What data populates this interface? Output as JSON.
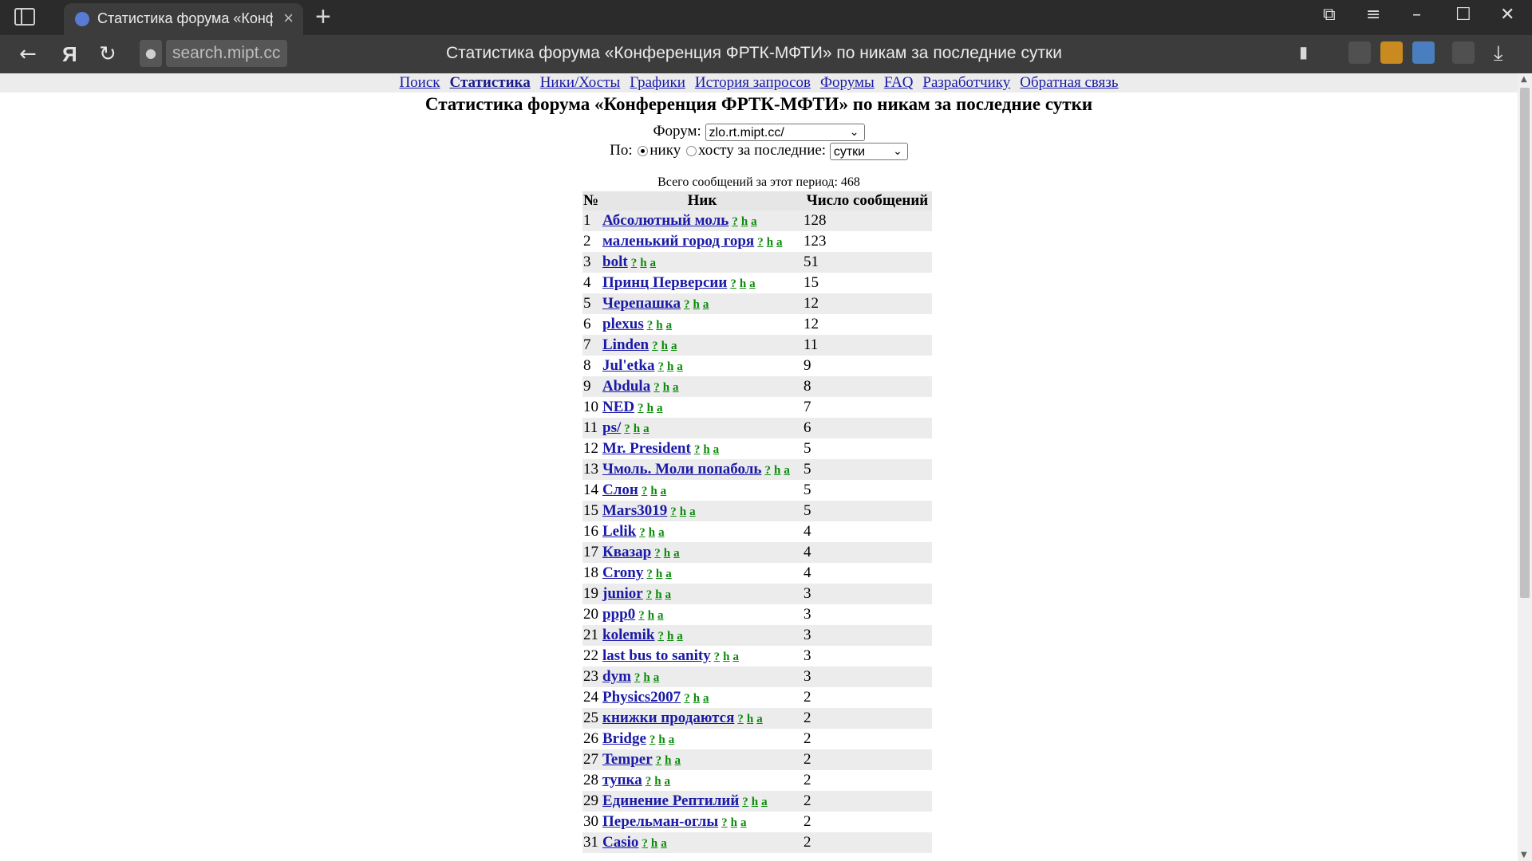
{
  "browser": {
    "tab_title": "Статистика форума «Конф",
    "address_host": "search.mipt.cc",
    "address_title": "Статистика форума «Конференция ФРТК-МФТИ» по никам за последние сутки"
  },
  "menu": [
    {
      "label": "Поиск",
      "active": false
    },
    {
      "label": "Статистика",
      "active": true
    },
    {
      "label": "Ники/Хосты",
      "active": false
    },
    {
      "label": "Графики",
      "active": false
    },
    {
      "label": "История запросов",
      "active": false
    },
    {
      "label": "Форумы",
      "active": false
    },
    {
      "label": "FAQ",
      "active": false
    },
    {
      "label": "Разработчику",
      "active": false
    },
    {
      "label": "Обратная связь",
      "active": false
    }
  ],
  "page_title": "Статистика форума «Конференция ФРТК-МФТИ» по никам за последние сутки",
  "form": {
    "forum_label": "Форум:",
    "forum_value": "zlo.rt.mipt.cc/",
    "by_label": "По:",
    "radio_nick": "нику",
    "radio_host": "хосту за последние:",
    "period_value": "сутки"
  },
  "total": "Всего сообщений за этот период: 468",
  "table": {
    "headers": [
      "№",
      "Ник",
      "Число сообщений"
    ],
    "link_labels": [
      "?",
      "h",
      "a"
    ],
    "rows": [
      {
        "n": "1",
        "nick": "Абсолютный моль",
        "count": "128"
      },
      {
        "n": "2",
        "nick": "маленький город горя",
        "count": "123"
      },
      {
        "n": "3",
        "nick": "bolt",
        "count": "51"
      },
      {
        "n": "4",
        "nick": "Принц Перверсии",
        "count": "15"
      },
      {
        "n": "5",
        "nick": "Черепашка",
        "count": "12"
      },
      {
        "n": "6",
        "nick": "plexus",
        "count": "12"
      },
      {
        "n": "7",
        "nick": "Linden",
        "count": "11"
      },
      {
        "n": "8",
        "nick": "Jul'etka",
        "count": "9"
      },
      {
        "n": "9",
        "nick": "Abdula",
        "count": "8"
      },
      {
        "n": "10",
        "nick": "NED",
        "count": "7"
      },
      {
        "n": "11",
        "nick": "ps/",
        "count": "6"
      },
      {
        "n": "12",
        "nick": "Mr. President",
        "count": "5"
      },
      {
        "n": "13",
        "nick": "Чмоль. Моли попаболь",
        "count": "5"
      },
      {
        "n": "14",
        "nick": "Слон",
        "count": "5"
      },
      {
        "n": "15",
        "nick": "Mars3019",
        "count": "5"
      },
      {
        "n": "16",
        "nick": "Lelik",
        "count": "4"
      },
      {
        "n": "17",
        "nick": "Квазар",
        "count": "4"
      },
      {
        "n": "18",
        "nick": "Crony",
        "count": "4"
      },
      {
        "n": "19",
        "nick": "junior",
        "count": "3"
      },
      {
        "n": "20",
        "nick": "ppp0",
        "count": "3"
      },
      {
        "n": "21",
        "nick": "kolemik",
        "count": "3"
      },
      {
        "n": "22",
        "nick": "last bus to sanity",
        "count": "3"
      },
      {
        "n": "23",
        "nick": "dym",
        "count": "3"
      },
      {
        "n": "24",
        "nick": "Physics2007",
        "count": "2"
      },
      {
        "n": "25",
        "nick": "книжки продаются",
        "count": "2"
      },
      {
        "n": "26",
        "nick": "Bridge",
        "count": "2"
      },
      {
        "n": "27",
        "nick": "Temper",
        "count": "2"
      },
      {
        "n": "28",
        "nick": "тупка",
        "count": "2"
      },
      {
        "n": "29",
        "nick": "Единение Рептилий",
        "count": "2"
      },
      {
        "n": "30",
        "nick": "Перельман-оглы",
        "count": "2"
      },
      {
        "n": "31",
        "nick": "Casio",
        "count": "2"
      }
    ]
  },
  "icons": {
    "sidebar": "sidebar-toggle-icon",
    "new_tab": "+",
    "close_tab": "×",
    "back": "←",
    "yandex": "Я",
    "reload": "↻",
    "lock": "🔒",
    "bookmark": "▮",
    "menu": "≡",
    "minimize": "–",
    "maximize": "☐",
    "close": "✕",
    "download": "⤓"
  }
}
